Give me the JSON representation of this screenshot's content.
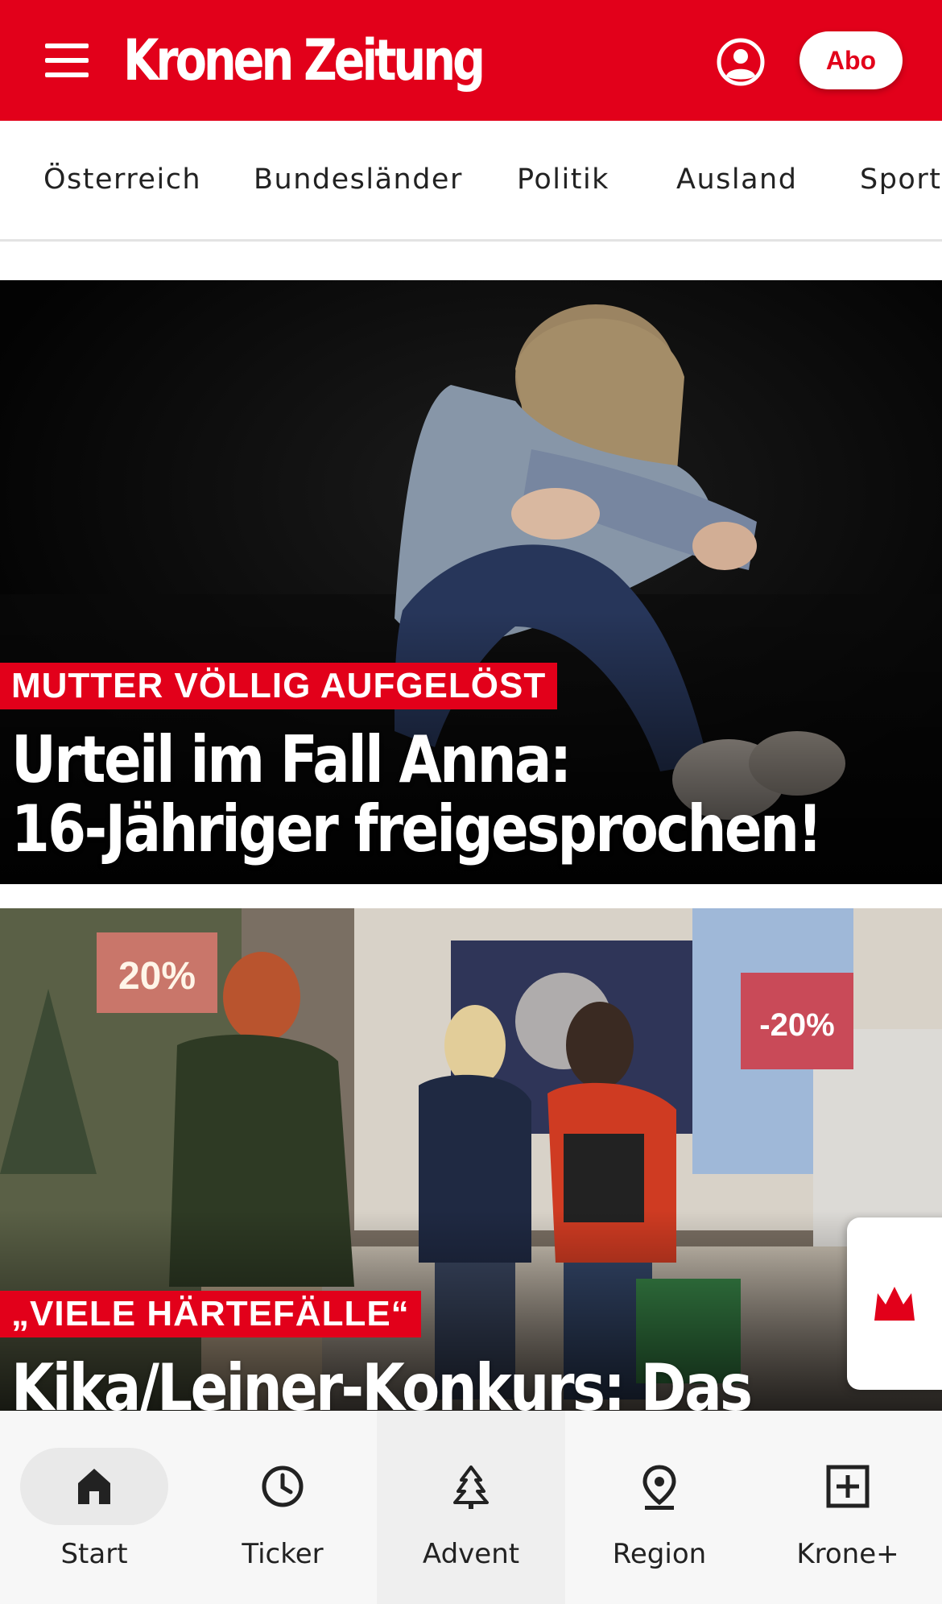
{
  "header": {
    "logo_text": "Kronen Zeitung",
    "abo_label": "Abo",
    "brand_color": "#e2001a",
    "icons": {
      "menu": "hamburger-menu-icon",
      "account": "user-account-icon"
    }
  },
  "categories": [
    "Österreich",
    "Bundesländer",
    "Politik",
    "Ausland",
    "Sport"
  ],
  "articles": [
    {
      "kicker": "MUTTER VÖLLIG AUFGELÖST",
      "headline_line1": "Urteil im Fall Anna:",
      "headline_line2": "16-Jähriger freigesprochen!"
    },
    {
      "kicker": "„VIELE HÄRTEFÄLLE“",
      "headline_line1": "Kika/Leiner-Konkurs: Das"
    }
  ],
  "bottom_nav": [
    {
      "label": "Start",
      "icon": "home-icon",
      "active": true
    },
    {
      "label": "Ticker",
      "icon": "clock-icon",
      "active": false
    },
    {
      "label": "Advent",
      "icon": "tree-icon",
      "active": false
    },
    {
      "label": "Region",
      "icon": "location-pin-icon",
      "active": false
    },
    {
      "label": "Krone+",
      "icon": "plus-box-icon",
      "active": false
    }
  ]
}
